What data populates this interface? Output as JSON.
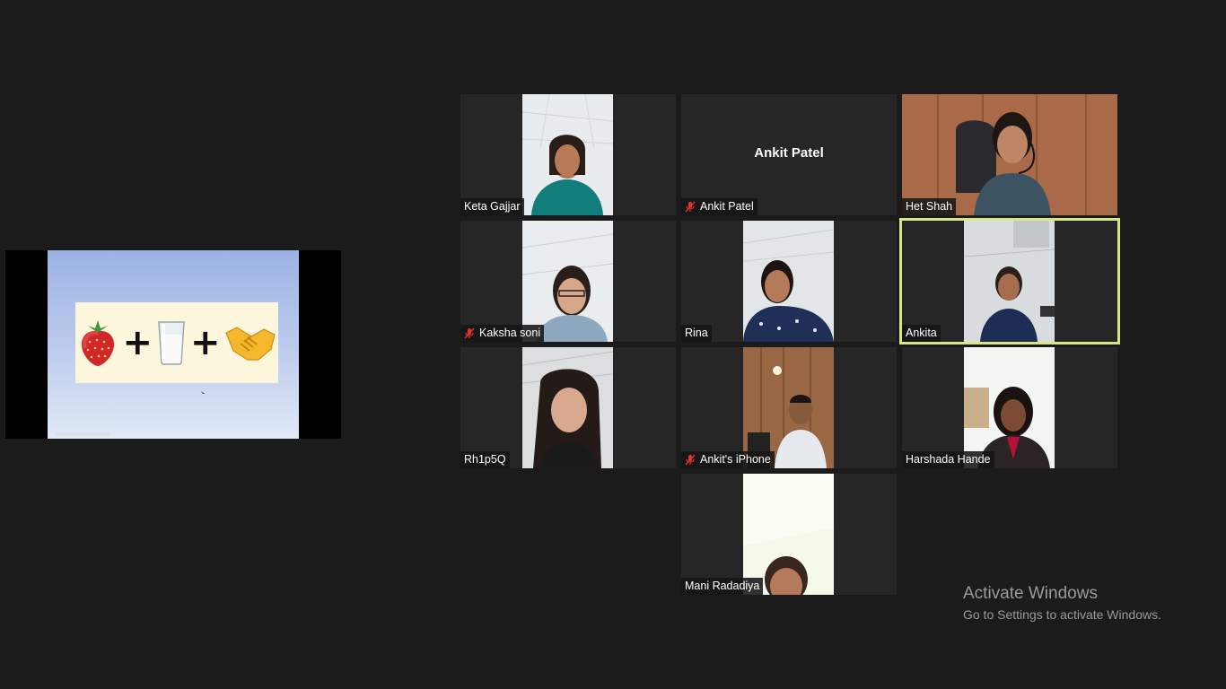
{
  "shared_screen": {
    "slide_items": [
      "strawberry-emoji",
      "plus",
      "milk-glass-emoji",
      "plus",
      "handshake-emoji"
    ],
    "plus_symbol": "+"
  },
  "participants": [
    {
      "name": "Keta Gajjar",
      "muted": false,
      "video": true
    },
    {
      "name": "Ankit Patel",
      "muted": true,
      "video": false,
      "display_text": "Ankit Patel"
    },
    {
      "name": "Het Shah",
      "muted": false,
      "video": true
    },
    {
      "name": "Kaksha soni",
      "muted": true,
      "video": true
    },
    {
      "name": "Rina",
      "muted": false,
      "video": true
    },
    {
      "name": "Ankita",
      "muted": false,
      "video": true,
      "active_speaker": true
    },
    {
      "name": "Rh1p5Q",
      "muted": false,
      "video": true
    },
    {
      "name": "Ankit's iPhone",
      "muted": true,
      "video": true
    },
    {
      "name": "Harshada Hande",
      "muted": false,
      "video": true
    },
    {
      "name": "Mani Radadiya",
      "muted": false,
      "video": true
    }
  ],
  "watermark": {
    "title": "Activate Windows",
    "subtitle": "Go to Settings to activate Windows."
  },
  "colors": {
    "background": "#1b1b1b",
    "tile": "#262626",
    "active_speaker_border": "#d9e58a",
    "muted_icon": "#e5322d"
  }
}
